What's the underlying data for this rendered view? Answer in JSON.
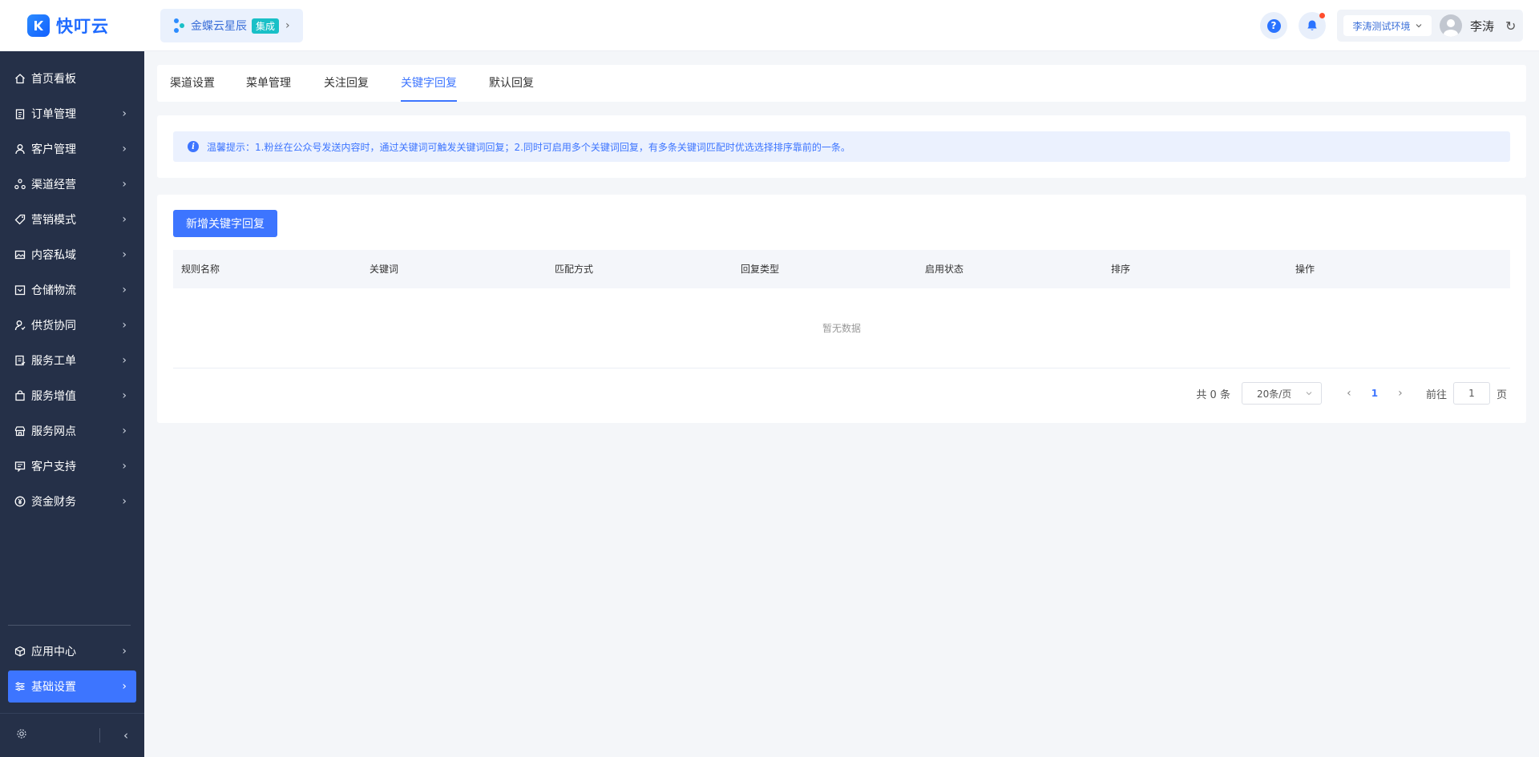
{
  "app": {
    "logo_text": "快叮云",
    "brand_color": "#1f6bff"
  },
  "org": {
    "name": "金蝶云星辰",
    "tag": "集成"
  },
  "header": {
    "env_label": "李涛测试环境",
    "user_name": "李涛"
  },
  "sidebar": {
    "items": [
      {
        "label": "首页看板",
        "icon": "home-icon",
        "has_arrow": false
      },
      {
        "label": "订单管理",
        "icon": "clipboard-icon",
        "has_arrow": true
      },
      {
        "label": "客户管理",
        "icon": "user-icon",
        "has_arrow": true
      },
      {
        "label": "渠道经营",
        "icon": "channel-icon",
        "has_arrow": true
      },
      {
        "label": "营销模式",
        "icon": "tag-icon",
        "has_arrow": true
      },
      {
        "label": "内容私域",
        "icon": "image-icon",
        "has_arrow": true
      },
      {
        "label": "仓储物流",
        "icon": "warehouse-icon",
        "has_arrow": true
      },
      {
        "label": "供货协同",
        "icon": "supply-user-icon",
        "has_arrow": true
      },
      {
        "label": "服务工单",
        "icon": "ticket-icon",
        "has_arrow": true
      },
      {
        "label": "服务增值",
        "icon": "bag-icon",
        "has_arrow": true
      },
      {
        "label": "服务网点",
        "icon": "store-icon",
        "has_arrow": true
      },
      {
        "label": "客户支持",
        "icon": "support-icon",
        "has_arrow": true
      },
      {
        "label": "资金财务",
        "icon": "yuan-icon",
        "has_arrow": true
      }
    ],
    "bottom_items": [
      {
        "label": "应用中心",
        "icon": "cube-icon"
      },
      {
        "label": "基础设置",
        "icon": "sliders-icon",
        "active": true
      }
    ]
  },
  "tabs": [
    "渠道设置",
    "菜单管理",
    "关注回复",
    "关键字回复",
    "默认回复"
  ],
  "active_tab": "关键字回复",
  "tip": "温馨提示：1.粉丝在公众号发送内容时，通过关键词可触发关键词回复；2.同时可启用多个关键词回复，有多条关键词匹配时优选选择排序靠前的一条。",
  "table": {
    "add_button": "新增关键字回复",
    "columns": [
      "规则名称",
      "关键词",
      "匹配方式",
      "回复类型",
      "启用状态",
      "排序",
      "操作"
    ],
    "empty_text": "暂无数据"
  },
  "pagination": {
    "total_text": "共 0 条",
    "page_size": "20条/页",
    "current_page": "1",
    "goto_label": "前往",
    "goto_value": "1",
    "goto_suffix": "页"
  }
}
